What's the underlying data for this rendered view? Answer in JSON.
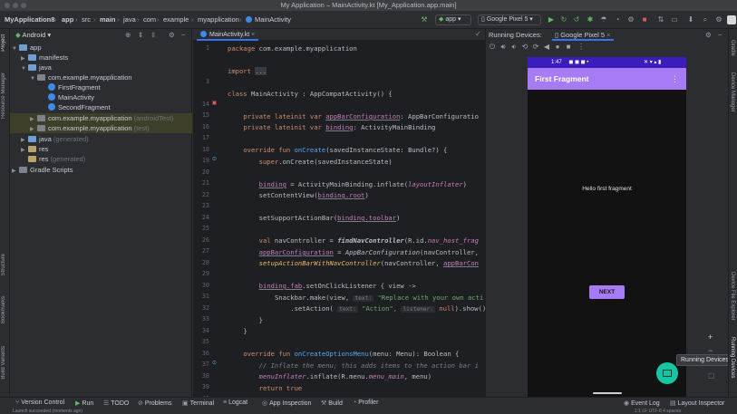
{
  "window": {
    "title": "My Application – MainActivity.kt [My_Application.app.main]"
  },
  "breadcrumbs": [
    "MyApplication8",
    "app",
    "src",
    "main",
    "java",
    "com",
    "example",
    "myapplication",
    "MainActivity"
  ],
  "toolbar": {
    "run_config": "app",
    "device": "Google Pixel 5"
  },
  "project_panel": {
    "view_selector": "Android",
    "tree": [
      {
        "label": "app",
        "suffix": ""
      },
      {
        "label": "manifests",
        "suffix": ""
      },
      {
        "label": "java",
        "suffix": ""
      },
      {
        "label": "com.example.myapplication",
        "suffix": ""
      },
      {
        "label": "FirstFragment",
        "suffix": ""
      },
      {
        "label": "MainActivity",
        "suffix": ""
      },
      {
        "label": "SecondFragment",
        "suffix": ""
      },
      {
        "label": "com.example.myapplication",
        "suffix": "(androidTest)"
      },
      {
        "label": "com.example.myapplication",
        "suffix": "(test)"
      },
      {
        "label": "java",
        "suffix": "(generated)"
      },
      {
        "label": "res",
        "suffix": ""
      },
      {
        "label": "res",
        "suffix": "(generated)"
      },
      {
        "label": "Gradle Scripts",
        "suffix": ""
      }
    ]
  },
  "left_tool_tabs": [
    "Project",
    "Resource Manager",
    "Structure",
    "Bookmarks",
    "Build Variants"
  ],
  "right_tool_tabs": [
    "Gradle",
    "Device Manager",
    "Device File Explorer",
    "Running Devices"
  ],
  "editor": {
    "tab": "MainActivity.kt",
    "line_numbers": [
      "1",
      "",
      "3",
      "",
      "14",
      "15",
      "16",
      "17",
      "18",
      "19",
      "20",
      "21",
      "22",
      "23",
      "24",
      "25",
      "26",
      "27",
      "28",
      "29",
      "30",
      "31",
      "32",
      "33",
      "34",
      "35",
      "36",
      "37",
      "38",
      "39",
      "40"
    ],
    "lines": {
      "l1_k": "package",
      "l1_t": " com.example.myapplication",
      "l3_k": "import",
      "l3_t": "...",
      "l14_k": "class",
      "l14_t": " MainActivity : AppCompatActivity() {",
      "l16_k": "private lateinit var",
      "l16_v": "appBarConfiguration",
      "l16_t": ": AppBarConfiguratio",
      "l17_k": "private lateinit var",
      "l17_v": "binding",
      "l17_t": ": ActivityMainBinding",
      "l19_k": "override fun",
      "l19_f": "onCreate",
      "l19_t": "(savedInstanceState: Bundle?) {",
      "l20_k": "super",
      "l20_t": ".onCreate(savedInstanceState)",
      "l22_v": "binding",
      "l22_t": " = ActivityMainBinding.inflate(",
      "l22_i": "layoutInflater",
      "l22_e": ")",
      "l23_t": "setContentView(",
      "l23_v": "binding.root",
      "l23_e": ")",
      "l25_t": "setSupportActionBar(",
      "l25_v": "binding.toolbar",
      "l25_e": ")",
      "l27_k": "val",
      "l27_t": " navController = ",
      "l27_f": "findNavController",
      "l27_e": "(R.id.",
      "l27_i": "nav_host_frag",
      "l28_v": "appBarConfiguration",
      "l28_t": " = ",
      "l28_f": "AppBarConfiguration",
      "l28_e": "(navController,",
      "l29_f": "setupActionBarWithNavController",
      "l29_t": "(navController, ",
      "l29_v": "appBarCon",
      "l31_v": "binding.fab",
      "l31_t": ".setOnClickListener { view ->",
      "l32_t": "Snackbar.make(view, ",
      "l32_h": "text:",
      "l32_s": "\"Replace with your own acti",
      "l33_t": ".setAction( ",
      "l33_h": "text:",
      "l33_s": "\"Action\",",
      "l33_h2": "listener:",
      "l33_k": "null",
      "l33_e": ").show()",
      "l34_t": "}",
      "l35_t": "}",
      "l37_k": "override fun",
      "l37_f": "onCreateOptionsMenu",
      "l37_t": "(menu: Menu): Boolean {",
      "l38_c": "// Inflate the menu; this adds items to the action bar i",
      "l39_i": "menuInflater",
      "l39_t": ".inflate(R.menu.",
      "l39_i2": "menu_main",
      "l39_e": ", menu)",
      "l40_k": "return true"
    }
  },
  "running_devices": {
    "label": "Running Devices:",
    "device_tab": "Google Pixel 5",
    "phone": {
      "time": "1:47",
      "app_title": "First Fragment",
      "overflow": "⋮",
      "message": "Hello first fragment",
      "button": "NEXT"
    },
    "tooltip": "Running Devices"
  },
  "bottom_tabs": [
    "Version Control",
    "Run",
    "TODO",
    "Problems",
    "Terminal",
    "Logcat",
    "App Inspection",
    "Build",
    "Profiler",
    "Event Log",
    "Layout Inspector"
  ],
  "status_bar": {
    "message": "Launch succeeded (moments ago)",
    "right": "1:1  LF  UTF-8  4 spaces"
  },
  "colors": {
    "accent": "#3574f0",
    "phone_status": "#3b1dbb",
    "app_bar": "#a77bf3",
    "fab": "#16c6a0"
  }
}
